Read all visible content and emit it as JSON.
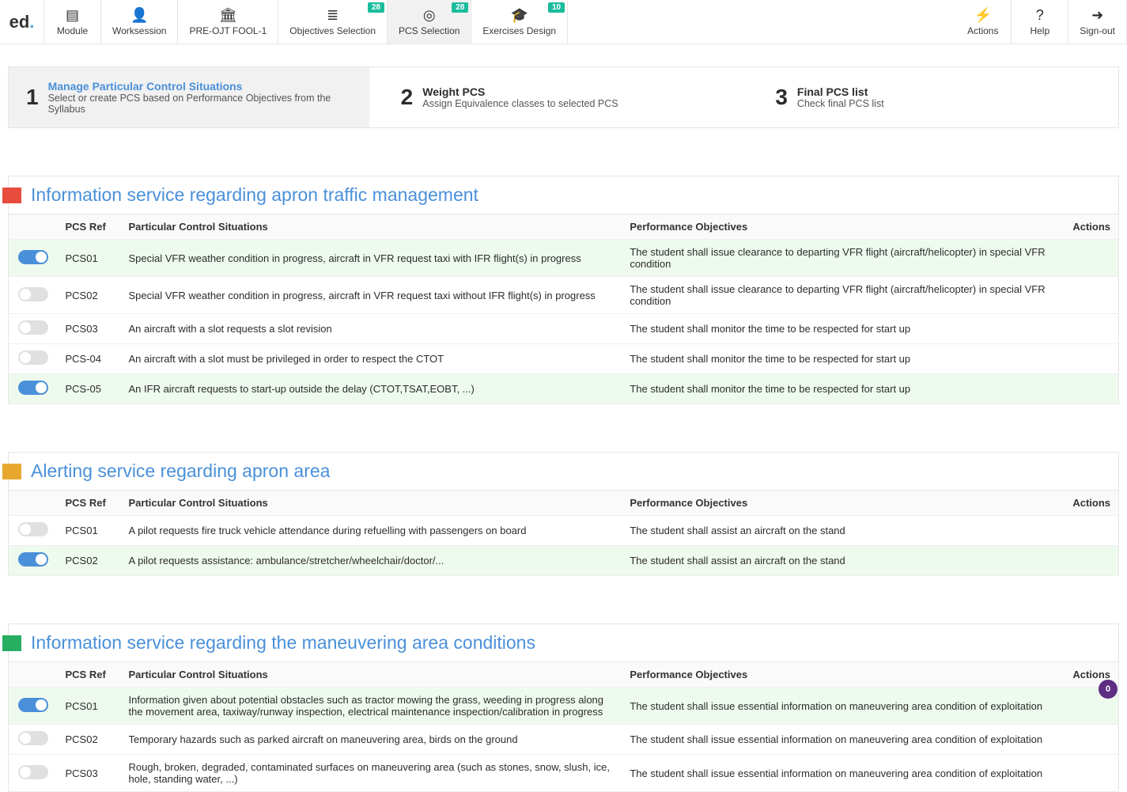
{
  "brand": {
    "text": "ed",
    "dot": "."
  },
  "nav": {
    "left": [
      {
        "icon": "book-icon",
        "glyph": "▤",
        "label": "Module"
      },
      {
        "icon": "person-icon",
        "glyph": "👤",
        "label": "Worksession"
      },
      {
        "icon": "bank-icon",
        "glyph": "🏛",
        "label": "PRE-OJT FOOL-1"
      },
      {
        "icon": "list-icon",
        "glyph": "≣",
        "label": "Objectives Selection",
        "badge": "28"
      },
      {
        "icon": "target-icon",
        "glyph": "◎",
        "label": "PCS Selection",
        "badge": "28",
        "active": true
      },
      {
        "icon": "grad-icon",
        "glyph": "🎓",
        "label": "Exercises Design",
        "badge": "10"
      }
    ],
    "right": [
      {
        "icon": "bolt-icon",
        "glyph": "⚡",
        "label": "Actions"
      },
      {
        "icon": "help-icon",
        "glyph": "?",
        "label": "Help"
      },
      {
        "icon": "signout-icon",
        "glyph": "➜",
        "label": "Sign-out"
      }
    ]
  },
  "steps": [
    {
      "num": "1",
      "title": "Manage Particular Control Situations",
      "sub": "Select or create PCS based on Performance Objectives from the Syllabus",
      "active": true
    },
    {
      "num": "2",
      "title": "Weight PCS",
      "sub": "Assign Equivalence classes to selected PCS"
    },
    {
      "num": "3",
      "title": "Final PCS list",
      "sub": "Check final PCS list"
    }
  ],
  "columns": {
    "ref": "PCS Ref",
    "sit": "Particular Control Situations",
    "obj": "Performance Objectives",
    "act": "Actions"
  },
  "sections": [
    {
      "flag": "red",
      "title": "Information service regarding apron traffic management",
      "rows": [
        {
          "on": true,
          "ref": "PCS01",
          "sit": "Special VFR weather condition in progress, aircraft in VFR request taxi with IFR flight(s) in progress",
          "obj": "The student shall issue clearance to departing VFR flight (aircraft/helicopter) in special VFR condition"
        },
        {
          "on": false,
          "ref": "PCS02",
          "sit": "Special VFR weather condition in progress, aircraft in VFR request taxi without IFR flight(s) in progress",
          "obj": "The student shall issue clearance to departing VFR flight (aircraft/helicopter) in special VFR condition"
        },
        {
          "on": false,
          "ref": "PCS03",
          "sit": "An aircraft with a slot requests a slot revision",
          "obj": "The student shall monitor the time to be respected for start up"
        },
        {
          "on": false,
          "ref": "PCS-04",
          "sit": "An aircraft with a slot must be privileged in order to respect the CTOT",
          "obj": "The student shall monitor the time to be respected for start up"
        },
        {
          "on": true,
          "ref": "PCS-05",
          "sit": "An IFR aircraft requests to start-up outside the delay (CTOT,TSAT,EOBT, ...)",
          "obj": "The student shall monitor the time to be respected for start up"
        }
      ]
    },
    {
      "flag": "orange",
      "title": "Alerting service regarding apron area",
      "rows": [
        {
          "on": false,
          "ref": "PCS01",
          "sit": "A pilot requests fire truck vehicle attendance during refuelling with passengers on board",
          "obj": "The student shall assist an aircraft on the stand"
        },
        {
          "on": true,
          "ref": "PCS02",
          "sit": "A pilot requests assistance: ambulance/stretcher/wheelchair/doctor/...",
          "obj": "The student shall assist an aircraft on the stand"
        }
      ]
    },
    {
      "flag": "green",
      "title": "Information service regarding the maneuvering area conditions",
      "rows": [
        {
          "on": true,
          "ref": "PCS01",
          "sit": "Information given about potential obstacles such as tractor mowing the grass, weeding in progress along the movement area, taxiway/runway inspection, electrical maintenance inspection/calibration in progress",
          "obj": "The student shall issue essential information on maneuvering area condition of exploitation"
        },
        {
          "on": false,
          "ref": "PCS02",
          "sit": "Temporary hazards such as parked aircraft on maneuvering area, birds on the ground",
          "obj": "The student shall issue essential information on maneuvering area condition of exploitation"
        },
        {
          "on": false,
          "ref": "PCS03",
          "sit": "Rough, broken, degraded, contaminated surfaces on maneuvering area (such as stones, snow, slush, ice, hole, standing water, ...)",
          "obj": "The student shall issue essential information on maneuvering area condition of exploitation"
        }
      ]
    }
  ],
  "fab": {
    "value": "0"
  }
}
